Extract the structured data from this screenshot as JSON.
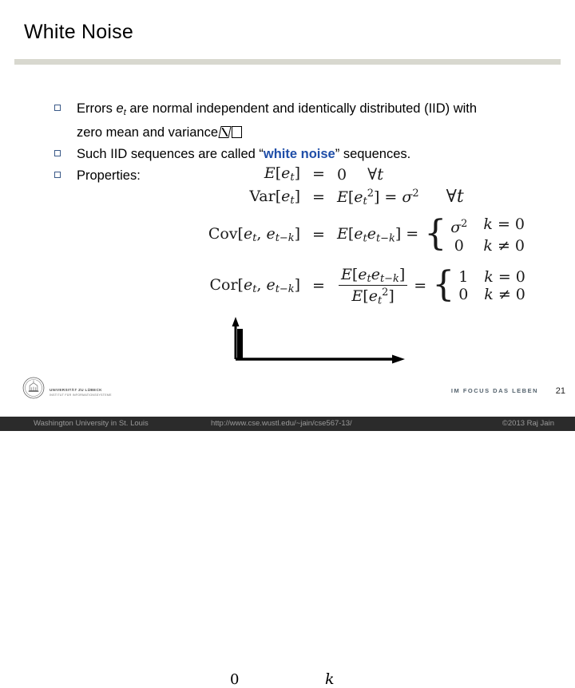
{
  "slide": {
    "title": "White Noise",
    "page_number": "21"
  },
  "bullets": [
    {
      "marker": "hollow-square",
      "segments": [
        {
          "text": "Errors "
        },
        {
          "text": "e",
          "style": "italic"
        },
        {
          "text": "t",
          "style": "subscript"
        },
        {
          "text": " are normal independent and identically distributed (IID) with zero mean and variance "
        },
        {
          "text": "□□",
          "style": "missing-glyph"
        }
      ],
      "plain": "Errors et are normal independent and identically distributed (IID) with zero mean and variance"
    },
    {
      "marker": "hollow-square",
      "segments": [
        {
          "text": "Such IID sequences are called “"
        },
        {
          "text": "white noise",
          "style": "bold-blue"
        },
        {
          "text": "” sequences."
        }
      ],
      "plain": "Such IID sequences are called “white noise” sequences."
    },
    {
      "marker": "hollow-square",
      "segments": [
        {
          "text": "Properties:"
        }
      ],
      "plain": "Properties:"
    }
  ],
  "equations": [
    {
      "id": "mean",
      "lhs": "E[eₜ]",
      "rel": "=",
      "rhs": "0",
      "qualifier": "∀t"
    },
    {
      "id": "variance",
      "lhs": "Var[eₜ]",
      "rel": "=",
      "rhs": "E[eₜ²] = σ²",
      "qualifier": "∀t"
    },
    {
      "id": "covariance",
      "lhs": "Cov[eₜ, eₜ₋ₖ]",
      "rel": "=",
      "rhs": "E[eₜ eₜ₋ₖ]",
      "cases": [
        {
          "value": "σ²",
          "condition": "k = 0"
        },
        {
          "value": "0",
          "condition": "k ≠ 0"
        }
      ]
    },
    {
      "id": "correlation",
      "lhs": "Cor[eₜ, eₜ₋ₖ]",
      "rel": "=",
      "rhs_numerator": "E[eₜ eₜ₋ₖ]",
      "rhs_denominator": "E[eₜ²]",
      "cases": [
        {
          "value": "1",
          "condition": "k = 0"
        },
        {
          "value": "0",
          "condition": "k ≠ 0"
        }
      ]
    }
  ],
  "chart_data": {
    "type": "bar",
    "title": "",
    "xlabel": "k",
    "ylabel": "",
    "categories": [
      "0"
    ],
    "values": [
      1
    ],
    "x_origin_label": "0",
    "xlim": [
      0,
      10
    ],
    "ylim": [
      0,
      1
    ],
    "grid": false,
    "legend": null,
    "description": "Autocorrelation function of white noise: a single spike of height 1 at lag k = 0 and zero at all other lags.",
    "axis_style": "arrow-tipped axes, no tick marks"
  },
  "footer": {
    "university_name": "UNIVERSITÄT ZU LÜBECK",
    "institute": "INSTITUT FÜR INFORMATIONSSYSTEME",
    "tagline": "IM FOCUS DAS LEBEN",
    "seal_icon": "university-seal-icon"
  },
  "bottom_bar": {
    "left": "Washington University in St. Louis",
    "center": "http://www.cse.wustl.edu/~jain/cse567-13/",
    "right": "©2013 Raj Jain"
  },
  "colors": {
    "accent_blue": "#1f4ea8",
    "rule_gray": "#d8d8cf",
    "bullet_outline": "#3b5a88",
    "bottom_bar_bg": "#2b2b2b",
    "bottom_bar_text": "#9a9a9a"
  }
}
